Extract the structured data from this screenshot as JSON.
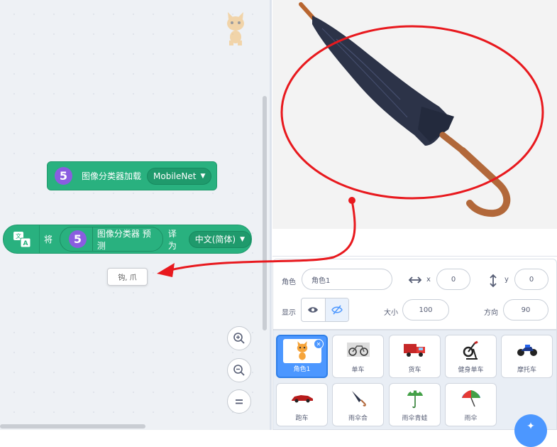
{
  "blocks": {
    "load": {
      "badge": "5",
      "text": "图像分类器加载",
      "dropdown": "MobileNet"
    },
    "translate": {
      "word_before": "将",
      "badge": "5",
      "reporter_text": "图像分类器 预测",
      "word_after": "译为",
      "dropdown": "中文(简体)"
    }
  },
  "tooltip": {
    "text": "钩, 爪"
  },
  "zoom": {
    "zoom_in_icon": "zoom-in-icon",
    "zoom_out_icon": "zoom-out-icon",
    "reset_icon": "zoom-reset-icon"
  },
  "sprite_info": {
    "sprite_label": "角色",
    "sprite_name": "角色1",
    "x_label": "x",
    "x_value": "0",
    "y_label": "y",
    "y_value": "0",
    "show_label": "显示",
    "size_label": "大小",
    "size_value": "100",
    "direction_label": "方向",
    "direction_value": "90"
  },
  "sprites": [
    {
      "name": "角色1",
      "selected": true
    },
    {
      "name": "单车"
    },
    {
      "name": "货车"
    },
    {
      "name": "健身单车"
    },
    {
      "name": "摩托车"
    },
    {
      "name": "跑车"
    },
    {
      "name": "雨伞合"
    },
    {
      "name": "雨伞青蛙"
    },
    {
      "name": "雨伞"
    }
  ],
  "colors": {
    "block_green": "#29b17f",
    "badge_purple": "#8a5de0",
    "annotation_red": "#e8191e",
    "accent_blue": "#4c97ff"
  }
}
